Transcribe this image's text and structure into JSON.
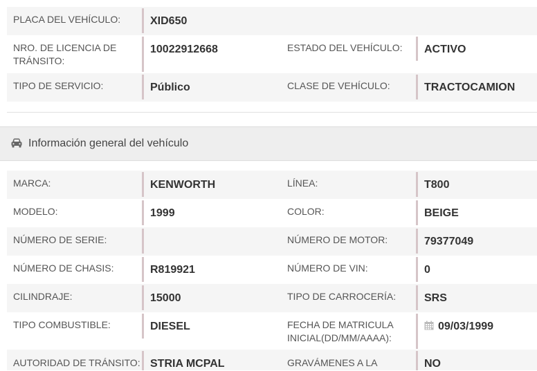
{
  "top_table": {
    "rows": [
      {
        "label1": "PLACA DEL VEHÍCULO:",
        "value1": "XID650",
        "label2": "",
        "value2": ""
      },
      {
        "label1": "NRO. DE LICENCIA DE TRÁNSITO:",
        "value1": "10022912668",
        "label2": "ESTADO DEL VEHÍCULO:",
        "value2": "ACTIVO"
      },
      {
        "label1": "TIPO DE SERVICIO:",
        "value1": "Público",
        "label2": "CLASE DE VEHÍCULO:",
        "value2": "TRACTOCAMION"
      }
    ]
  },
  "section": {
    "title": "Información general del vehículo",
    "icon": "car-icon"
  },
  "general_table": {
    "rows": [
      {
        "label1": "MARCA:",
        "value1": "KENWORTH",
        "label2": "LÍNEA:",
        "value2": "T800"
      },
      {
        "label1": "MODELO:",
        "value1": "1999",
        "label2": "COLOR:",
        "value2": "BEIGE"
      },
      {
        "label1": "NÚMERO DE SERIE:",
        "value1": "",
        "label2": "NÚMERO DE MOTOR:",
        "value2": "79377049"
      },
      {
        "label1": "NÚMERO DE CHASIS:",
        "value1": "R819921",
        "label2": "NÚMERO DE VIN:",
        "value2": "0"
      },
      {
        "label1": "CILINDRAJE:",
        "value1": "15000",
        "label2": "TIPO DE CARROCERÍA:",
        "value2": "SRS"
      },
      {
        "label1": "TIPO COMBUSTIBLE:",
        "value1": "DIESEL",
        "label2": "FECHA DE MATRICULA INICIAL(DD/MM/AAAA):",
        "value2": "09/03/1999"
      },
      {
        "label1": "AUTORIDAD DE TRÁNSITO:",
        "value1": "STRIA MCPAL",
        "label2": "GRAVÁMENES A LA",
        "value2": "NO"
      }
    ]
  },
  "colors": {
    "accent_bar": "#d6c5c8",
    "shaded_row": "#f5f5f5",
    "section_bg": "#eeeeee"
  }
}
